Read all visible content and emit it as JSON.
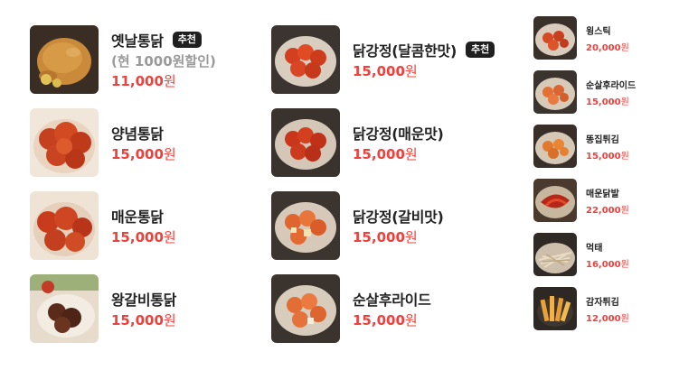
{
  "colors": {
    "price": "#f0403c",
    "badge_bg": "#1f1f1f",
    "subtext": "#9a9a9a"
  },
  "currency": "원",
  "left_menu": [
    {
      "name": "옛날통닭",
      "badge": "추천",
      "sub": "(현 1000원할인)",
      "price": "11,000",
      "icon": "whole-chicken-image"
    },
    {
      "name": "양념통닭",
      "price": "15,000",
      "icon": "seasoned-chicken-image"
    },
    {
      "name": "매운통닭",
      "price": "15,000",
      "icon": "spicy-chicken-image"
    },
    {
      "name": "왕갈비통닭",
      "price": "15,000",
      "icon": "galbi-chicken-image"
    }
  ],
  "mid_menu": [
    {
      "name": "닭강정(달콤한맛)",
      "badge": "추천",
      "price": "15,000",
      "icon": "sweet-gangjeong-image"
    },
    {
      "name": "닭강정(매운맛)",
      "price": "15,000",
      "icon": "spicy-gangjeong-image"
    },
    {
      "name": "닭강정(갈비맛)",
      "price": "15,000",
      "icon": "galbi-gangjeong-image"
    },
    {
      "name": "순살후라이드",
      "price": "15,000",
      "icon": "boneless-fried-image"
    }
  ],
  "side_menu": [
    {
      "name": "윙스틱",
      "price": "20,000",
      "icon": "wingstick-image"
    },
    {
      "name": "순살후라이드",
      "price": "15,000",
      "icon": "boneless-fried-small-image"
    },
    {
      "name": "똥집튀김",
      "price": "15,000",
      "icon": "gizzard-fried-image"
    },
    {
      "name": "매운닭발",
      "price": "22,000",
      "icon": "spicy-feet-image"
    },
    {
      "name": "먹태",
      "price": "16,000",
      "icon": "dried-pollack-image"
    },
    {
      "name": "감자튀김",
      "price": "12,000",
      "icon": "fries-image"
    }
  ]
}
